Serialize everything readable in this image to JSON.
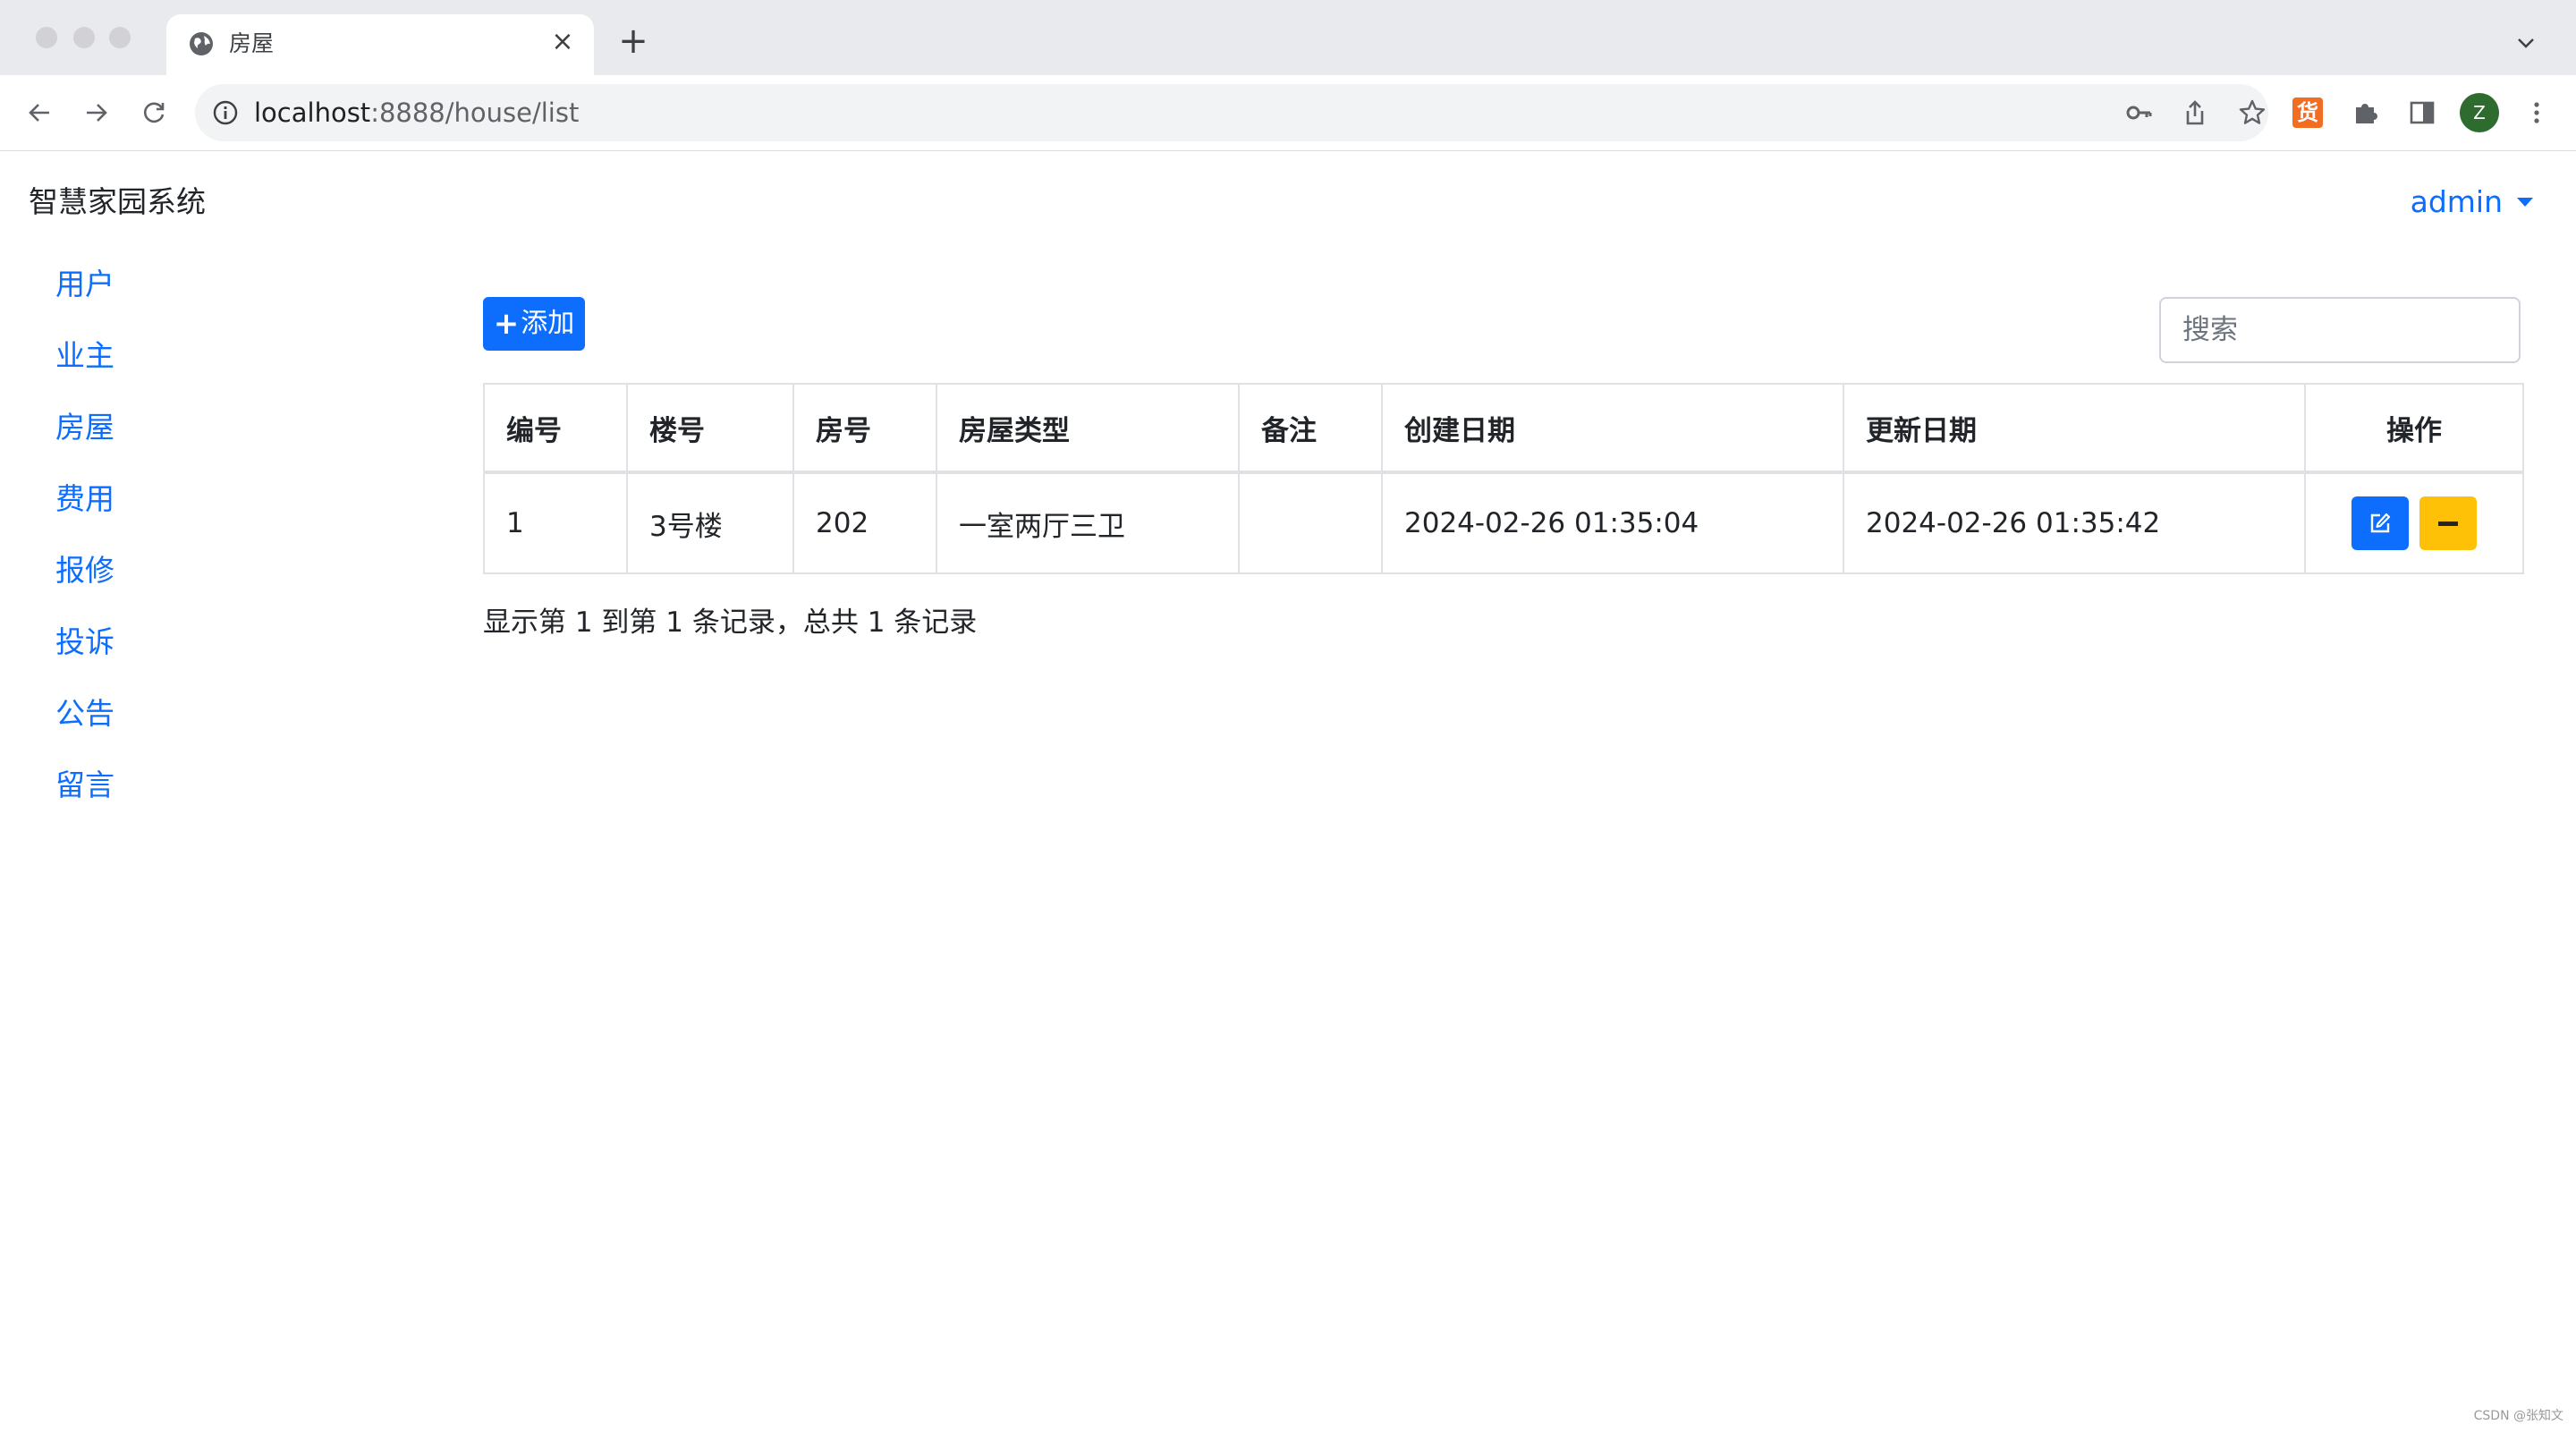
{
  "browser": {
    "tab_title": "房屋",
    "url_host": "localhost",
    "url_path": ":8888/house/list",
    "profile_initial": "Z",
    "extension_label": "货"
  },
  "app": {
    "brand": "智慧家园系统",
    "user": "admin",
    "sidebar": [
      "用户",
      "业主",
      "房屋",
      "费用",
      "报修",
      "投诉",
      "公告",
      "留言"
    ],
    "add_button": "添加",
    "search_placeholder": "搜索",
    "table": {
      "headers": [
        "编号",
        "楼号",
        "房号",
        "房屋类型",
        "备注",
        "创建日期",
        "更新日期",
        "操作"
      ],
      "rows": [
        [
          "1",
          "3号楼",
          "202",
          "一室两厅三卫",
          "",
          "2024-02-26 01:35:04",
          "2024-02-26 01:35:42"
        ]
      ]
    },
    "pagination_info": "显示第 1 到第 1 条记录，总共 1 条记录"
  },
  "watermark": "CSDN @张知文",
  "colors": {
    "primary": "#0d6efd",
    "warning": "#ffc107"
  }
}
